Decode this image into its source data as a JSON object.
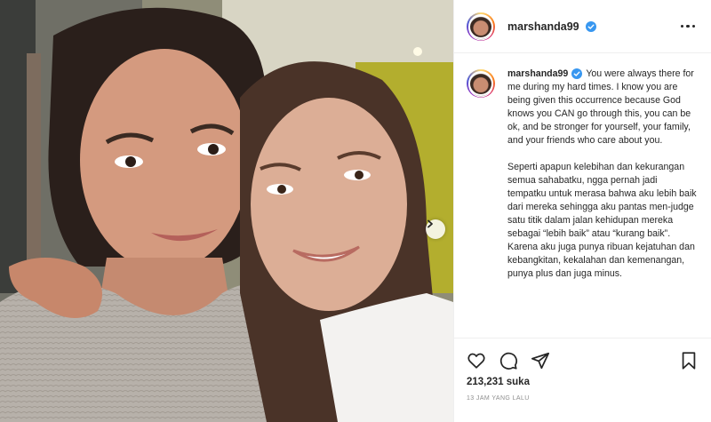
{
  "post": {
    "username": "marshanda99",
    "verified": true,
    "caption_paragraphs": [
      "You were always there for me during my hard times. I know you are being given this occurrence because God knows you CAN go through this, you can be ok, and be stronger for yourself, your family, and your friends who care about you.",
      "Seperti apapun kelebihan dan kekurangan semua sahabatku, ngga pernah jadi tempatku untuk merasa bahwa aku lebih baik dari mereka sehingga aku pantas men-judge satu titik dalam jalan kehidupan mereka sebagai “lebih baik” atau “kurang baik”. Karena aku juga punya ribuan kejatuhan dan kebangkitan, kekalahan dan kemenangan, punya plus dan juga minus."
    ],
    "likes": "213,231 suka",
    "timestamp": "13 JAM YANG LALU"
  },
  "icons": {
    "verified": "verified-badge-icon",
    "more": "more-options-icon",
    "like": "heart-icon",
    "comment": "comment-icon",
    "share": "share-icon",
    "save": "bookmark-icon",
    "next": "chevron-right-icon"
  },
  "colors": {
    "verified_blue": "#3897f0",
    "text": "#262626",
    "muted": "#8e8e8e",
    "border": "#efefef"
  }
}
